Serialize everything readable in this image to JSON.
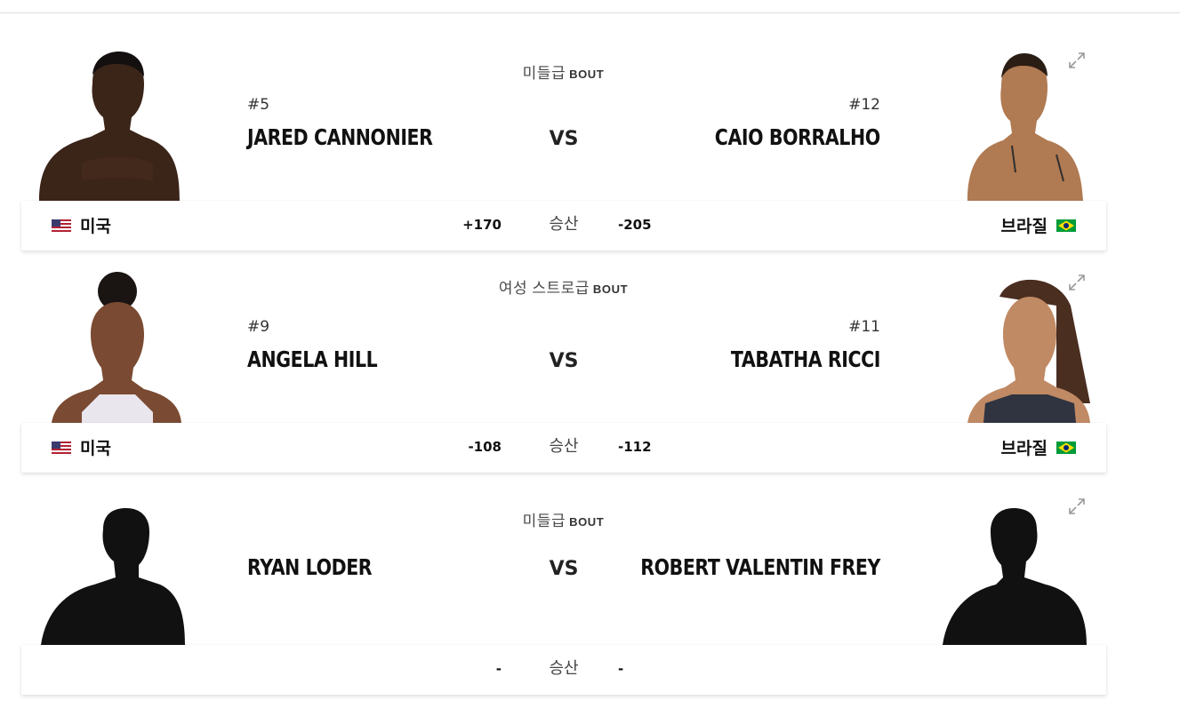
{
  "bouts": [
    {
      "weight_class": "미들급",
      "bout_word": "BOUT",
      "red": {
        "rank": "#5",
        "name": "JARED CANNONIER",
        "country": "미국",
        "odds": "+170"
      },
      "blue": {
        "rank": "#12",
        "name": "CAIO BORRALHO",
        "country": "브라질",
        "odds": "-205"
      },
      "vs": "VS",
      "odds_label": "승산"
    },
    {
      "weight_class": "여성 스트로급",
      "bout_word": "BOUT",
      "red": {
        "rank": "#9",
        "name": "ANGELA HILL",
        "country": "미국",
        "odds": "-108"
      },
      "blue": {
        "rank": "#11",
        "name": "TABATHA RICCI",
        "country": "브라질",
        "odds": "-112"
      },
      "vs": "VS",
      "odds_label": "승산"
    },
    {
      "weight_class": "미들급",
      "bout_word": "BOUT",
      "red": {
        "rank": "",
        "name": "RYAN LODER",
        "country": "",
        "odds": "-"
      },
      "blue": {
        "rank": "",
        "name": "ROBERT VALENTIN FREY",
        "country": "",
        "odds": "-"
      },
      "vs": "VS",
      "odds_label": "승산"
    }
  ],
  "icons": {
    "expand": "expand-icon",
    "flag_us": "us-flag-icon",
    "flag_br": "brazil-flag-icon"
  },
  "colors": {
    "text": "#111111",
    "muted": "#4a4a4a",
    "skin_dark": "#3b2418",
    "skin_tan": "#b07a52",
    "silhouette": "#111111"
  }
}
